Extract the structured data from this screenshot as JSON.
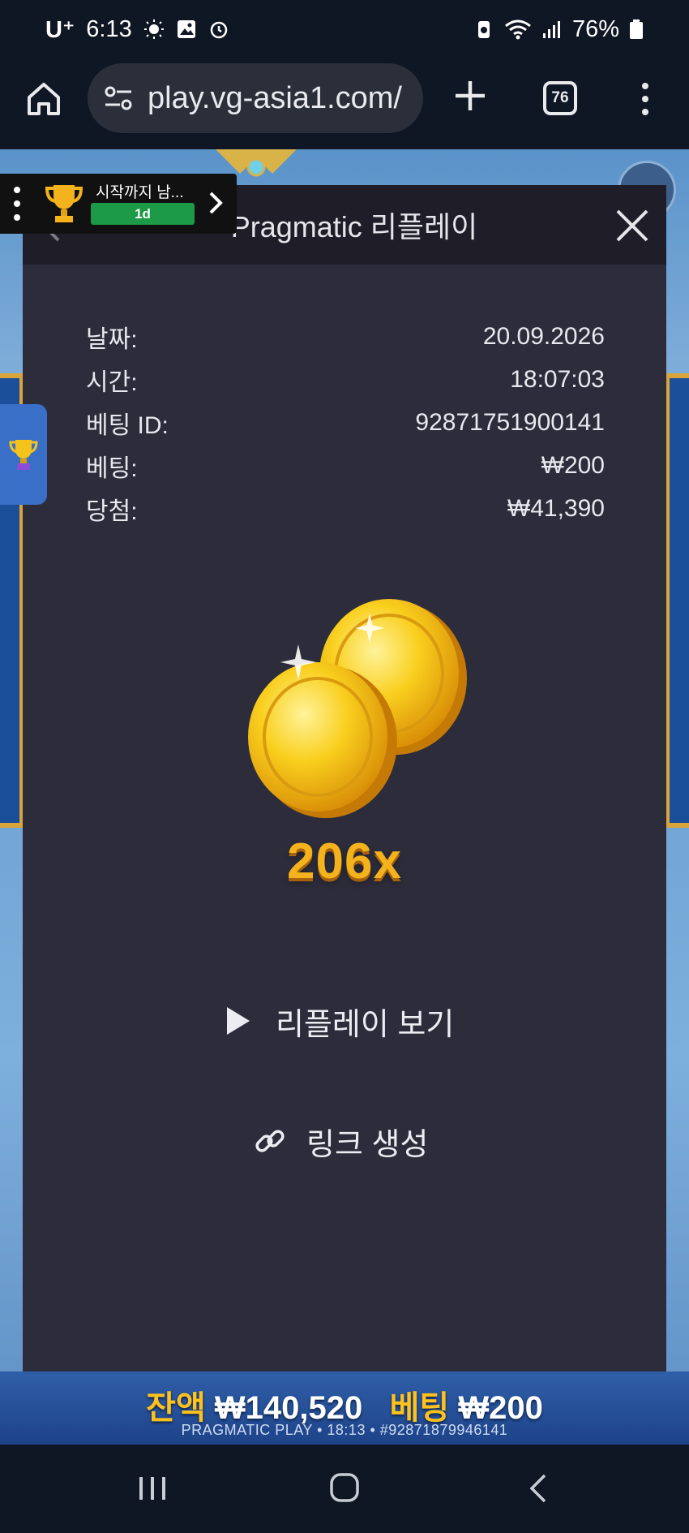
{
  "status_bar": {
    "carrier": "U⁺",
    "time": "6:13",
    "battery": "76%"
  },
  "browser": {
    "url": "play.vg-asia1.com/",
    "tab_count": "76",
    "icons": [
      "home-icon",
      "site-settings-icon",
      "new-tab-icon",
      "tab-switcher-icon",
      "more-options-icon"
    ]
  },
  "tournament": {
    "label": "시작까지 남...",
    "badge": "1d"
  },
  "modal": {
    "title": "Pragmatic 리플레이",
    "rows": [
      {
        "label": "날짜:",
        "value": "20.09.2026"
      },
      {
        "label": "시간:",
        "value": "18:07:03"
      },
      {
        "label": "베팅 ID:",
        "value": "92871751900141"
      },
      {
        "label": "베팅:",
        "value": "₩200"
      },
      {
        "label": "당첨:",
        "value": "₩41,390"
      }
    ],
    "multiplier": "206x",
    "replay_label": "리플레이 보기",
    "link_label": "링크 생성"
  },
  "game_bar": {
    "balance_label": "잔액",
    "balance_value": "₩140,520",
    "bet_label": "베팅",
    "bet_value": "₩200",
    "footer": "PRAGMATIC PLAY • 18:13 • #92871879946141"
  },
  "colors": {
    "accent_gold": "#f4b21c",
    "modal_bg": "#2d2c3b",
    "badge_green": "#1d9a47"
  }
}
